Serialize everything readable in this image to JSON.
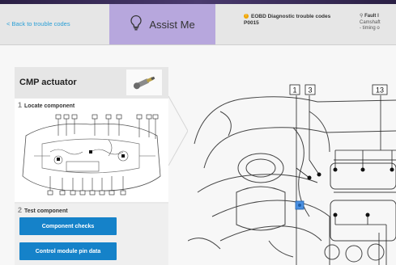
{
  "topbar": {
    "back_label": "< Back to trouble codes",
    "assist_label": "Assist Me",
    "code_title": "EOBD Diagnostic trouble codes",
    "code_value": "P0015",
    "fault_title": "Fault l",
    "fault_line1": "Camshaft",
    "fault_line2": "- timing o"
  },
  "panel": {
    "title": "CMP actuator",
    "step1_num": "1",
    "step1_title": "Locate component",
    "step2_num": "2",
    "step2_title": "Test component",
    "buttons": [
      "Component checks",
      "Control module pin data"
    ]
  },
  "diagram": {
    "callouts": [
      "1",
      "3",
      "13"
    ]
  },
  "colors": {
    "assist_bg": "#b7a7dd",
    "button_blue": "#1582c9",
    "link_blue": "#2a9fd6",
    "highlight_blue": "#4a90e2"
  }
}
